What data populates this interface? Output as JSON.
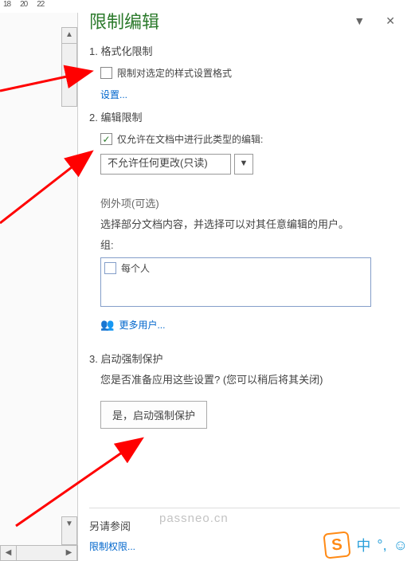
{
  "ruler": {
    "t1": "18",
    "t2": "20",
    "t3": "22"
  },
  "panel": {
    "title": "限制编辑",
    "section1": {
      "head": "1. 格式化限制",
      "checkbox_label": "限制对选定的样式设置格式",
      "settings_link": "设置..."
    },
    "section2": {
      "head": "2. 编辑限制",
      "checkbox_label": "仅允许在文档中进行此类型的编辑:",
      "dropdown_value": "不允许任何更改(只读)",
      "exception_head": "例外项(可选)",
      "exception_text": "选择部分文档内容，并选择可以对其任意编辑的用户。",
      "group_label": "组:",
      "group_item": "每个人",
      "more_users": "更多用户..."
    },
    "section3": {
      "head": "3. 启动强制保护",
      "body": "您是否准备应用这些设置? (您可以稍后将其关闭)",
      "button": "是，启动强制保护"
    },
    "see_also": {
      "head": "另请参阅",
      "link": "限制权限..."
    }
  },
  "watermark": "passneo.cn",
  "ime": {
    "badge": "S",
    "txt1": "中",
    "txt2": "°,",
    "txt3": "☺"
  }
}
